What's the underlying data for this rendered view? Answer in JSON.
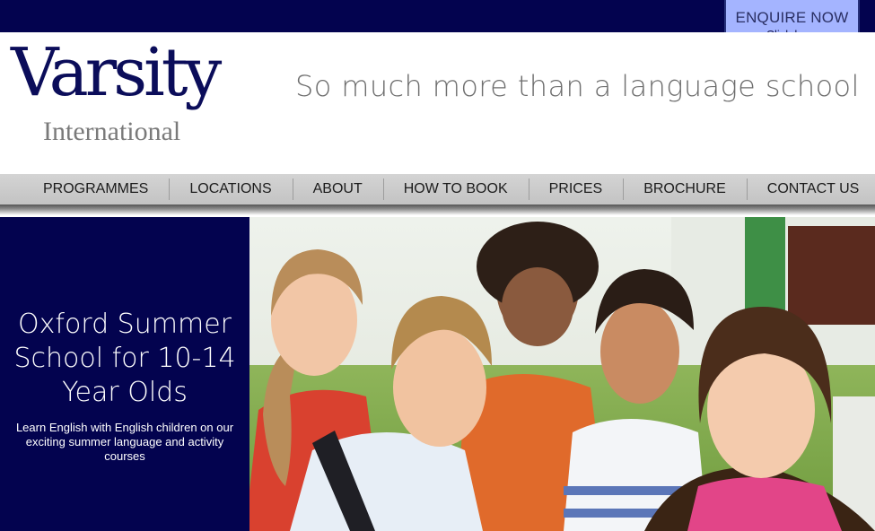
{
  "header": {
    "enquire_button": {
      "label": "ENQUIRE NOW",
      "sublabel": "Click here"
    },
    "logo": {
      "name": "Varsity",
      "subname": "International"
    },
    "tagline": "So much more than a language school"
  },
  "nav": {
    "items": [
      {
        "label": "PROGRAMMES"
      },
      {
        "label": "LOCATIONS"
      },
      {
        "label": "ABOUT"
      },
      {
        "label": "HOW TO BOOK"
      },
      {
        "label": "PRICES"
      },
      {
        "label": "BROCHURE"
      },
      {
        "label": "CONTACT US"
      }
    ]
  },
  "hero": {
    "title": "Oxford Summer School for 10-14 Year Olds",
    "subtitle": "Learn English with English children on our exciting summer language and activity courses",
    "image": "group-of-smiling-children-photo"
  },
  "colors": {
    "navy": "#03034f",
    "enquire_bg": "#a4b4ff",
    "nav_bg": "#c8c8c8",
    "tagline_gray": "#6e6e6e"
  }
}
